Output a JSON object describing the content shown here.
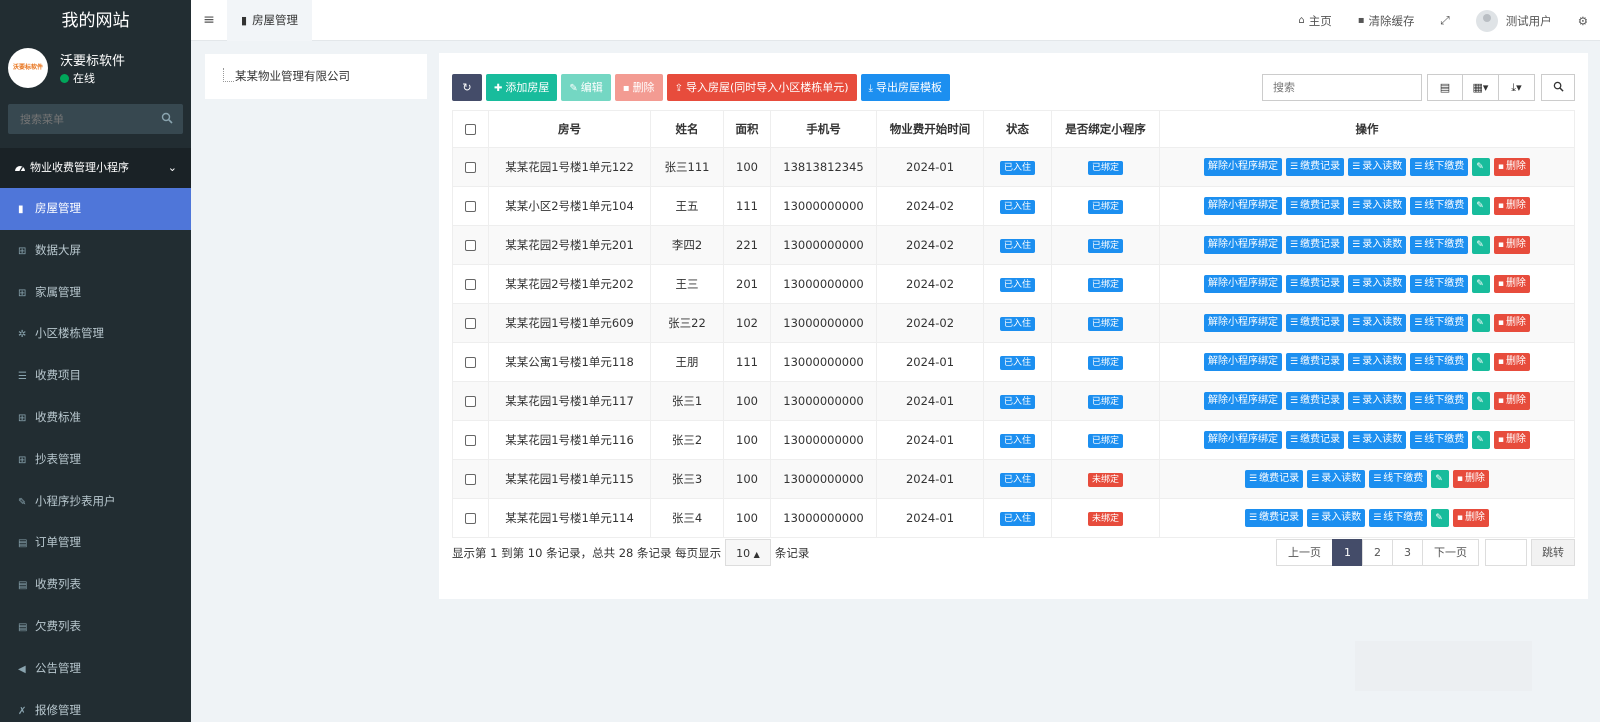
{
  "sidebar": {
    "site_title": "我的网站",
    "avatar_text": "沃要标软件",
    "user_name": "沃要标软件",
    "user_status": "在线",
    "search_placeholder": "搜索菜单",
    "group_title": "物业收费管理小程序",
    "items": [
      {
        "label": "房屋管理",
        "icon": "building-icon",
        "glyph": "▮",
        "active": true
      },
      {
        "label": "数据大屏",
        "icon": "table-icon",
        "glyph": "⊞"
      },
      {
        "label": "家属管理",
        "icon": "table-icon",
        "glyph": "⊞"
      },
      {
        "label": "小区楼栋管理",
        "icon": "gear-icon",
        "glyph": "✲"
      },
      {
        "label": "收费项目",
        "icon": "list-icon",
        "glyph": "☰"
      },
      {
        "label": "收费标准",
        "icon": "table-icon",
        "glyph": "⊞"
      },
      {
        "label": "抄表管理",
        "icon": "table-icon",
        "glyph": "⊞"
      },
      {
        "label": "小程序抄表用户",
        "icon": "edit-icon",
        "glyph": "✎"
      },
      {
        "label": "订单管理",
        "icon": "list-alt-icon",
        "glyph": "▤"
      },
      {
        "label": "收费列表",
        "icon": "list-alt-icon",
        "glyph": "▤"
      },
      {
        "label": "欠费列表",
        "icon": "list-alt-icon",
        "glyph": "▤"
      },
      {
        "label": "公告管理",
        "icon": "bullhorn-icon",
        "glyph": "◀"
      },
      {
        "label": "报修管理",
        "icon": "wrench-icon",
        "glyph": "✗"
      }
    ]
  },
  "topbar": {
    "tab_label": "房屋管理",
    "home": "主页",
    "clear_cache": "清除缓存",
    "user": "测试用户"
  },
  "tree": {
    "root": "某某物业管理有限公司"
  },
  "toolbar": {
    "add": "添加房屋",
    "edit": "编辑",
    "delete": "删除",
    "import": "导入房屋(同时导入小区楼栋单元)",
    "export_template": "导出房屋模板",
    "search_placeholder": "搜索"
  },
  "table": {
    "headers": [
      "房号",
      "姓名",
      "面积",
      "手机号",
      "物业费开始时间",
      "状态",
      "是否绑定小程序",
      "操作"
    ],
    "rows": [
      {
        "room": "某某花园1号楼1单元122",
        "name": "张三111",
        "area": "100",
        "phone": "13813812345",
        "start": "2024-01",
        "status": "已入住",
        "bound": "已绑定"
      },
      {
        "room": "某某小区2号楼1单元104",
        "name": "王五",
        "area": "111",
        "phone": "13000000000",
        "start": "2024-02",
        "status": "已入住",
        "bound": "已绑定"
      },
      {
        "room": "某某花园2号楼1单元201",
        "name": "李四2",
        "area": "221",
        "phone": "13000000000",
        "start": "2024-02",
        "status": "已入住",
        "bound": "已绑定"
      },
      {
        "room": "某某花园2号楼1单元202",
        "name": "王三",
        "area": "201",
        "phone": "13000000000",
        "start": "2024-02",
        "status": "已入住",
        "bound": "已绑定"
      },
      {
        "room": "某某花园1号楼1单元609",
        "name": "张三22",
        "area": "102",
        "phone": "13000000000",
        "start": "2024-02",
        "status": "已入住",
        "bound": "已绑定"
      },
      {
        "room": "某某公寓1号楼1单元118",
        "name": "王朋",
        "area": "111",
        "phone": "13000000000",
        "start": "2024-01",
        "status": "已入住",
        "bound": "已绑定"
      },
      {
        "room": "某某花园1号楼1单元117",
        "name": "张三1",
        "area": "100",
        "phone": "13000000000",
        "start": "2024-01",
        "status": "已入住",
        "bound": "已绑定"
      },
      {
        "room": "某某花园1号楼1单元116",
        "name": "张三2",
        "area": "100",
        "phone": "13000000000",
        "start": "2024-01",
        "status": "已入住",
        "bound": "已绑定"
      },
      {
        "room": "某某花园1号楼1单元115",
        "name": "张三3",
        "area": "100",
        "phone": "13000000000",
        "start": "2024-01",
        "status": "已入住",
        "bound": "未绑定"
      },
      {
        "room": "某某花园1号楼1单元114",
        "name": "张三4",
        "area": "100",
        "phone": "13000000000",
        "start": "2024-01",
        "status": "已入住",
        "bound": "未绑定"
      }
    ],
    "ops": {
      "unbind": "解除小程序绑定",
      "pay_record": "缴费记录",
      "meter": "录入读数",
      "offline_pay": "线下缴费",
      "delete": "删除"
    }
  },
  "pagination": {
    "summary": "显示第 1 到第 10 条记录，总共 28 条记录 每页显示",
    "page_size": "10",
    "suffix": "条记录",
    "prev": "上一页",
    "pages": [
      "1",
      "2",
      "3"
    ],
    "next": "下一页",
    "jump": "跳转"
  }
}
